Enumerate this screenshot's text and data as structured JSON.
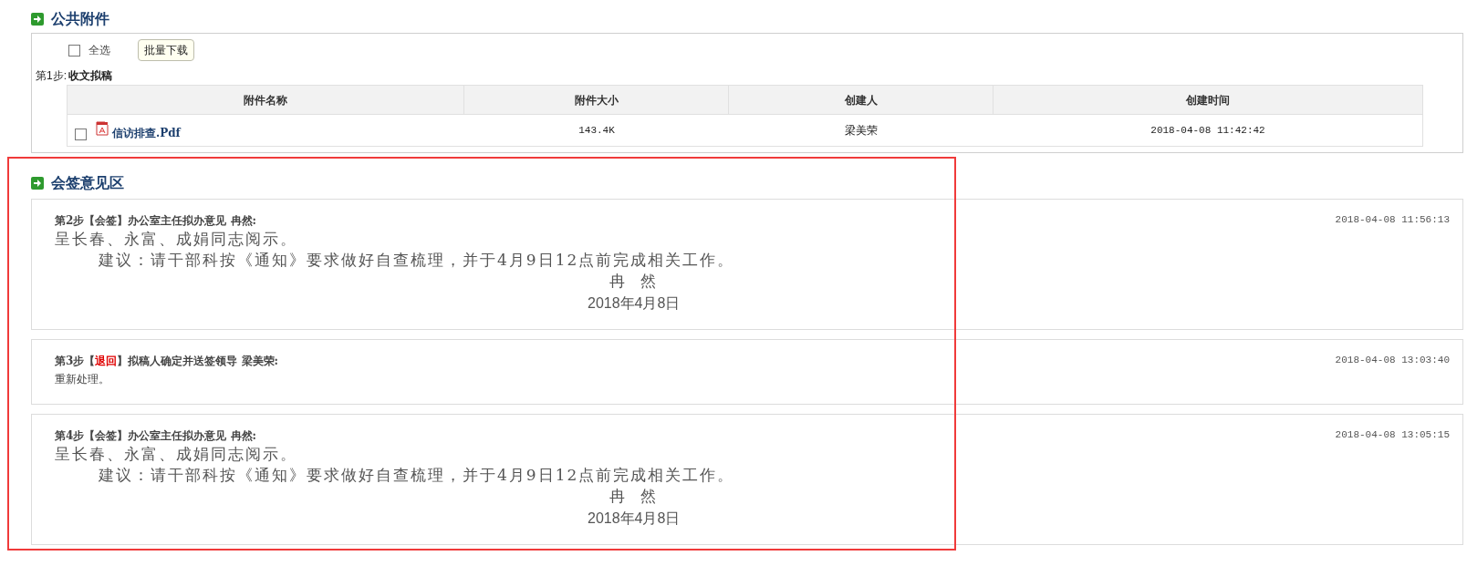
{
  "attachments": {
    "title": "公共附件",
    "select_all": {
      "label": "全选",
      "checked": false
    },
    "batch_button": "批量下载",
    "step": {
      "prefix": "第1步:",
      "name": "收文拟稿"
    },
    "columns": [
      "附件名称",
      "附件大小",
      "创建人",
      "创建时间"
    ],
    "rows": [
      {
        "checked": false,
        "name": "信访排查.Pdf",
        "size": "143.4K",
        "creator": "梁美荣",
        "time": "2018-04-08 11:42:42"
      }
    ]
  },
  "opinions": {
    "title": "会签意见区",
    "entries": [
      {
        "prefix": "第2步【",
        "tag": "会签",
        "kind": "countersign",
        "suffix": "】办公室主任拟办意见 冉然:",
        "time": "2018-04-08 11:56:13",
        "lines": [
          {
            "kind": "large",
            "text": "呈长春、永富、成娟同志阅示。"
          },
          {
            "kind": "indent",
            "text": "建议：请干部科按《通知》要求做好自查梳理，并于4月9日12点前完成相关工作。"
          },
          {
            "kind": "sign",
            "text": "冉　然"
          },
          {
            "kind": "date",
            "text": "2018年4月8日"
          }
        ]
      },
      {
        "prefix": "第3步【",
        "tag": "退回",
        "kind": "return",
        "suffix": "】拟稿人确定并送签领导 梁美荣:",
        "time": "2018-04-08 13:03:40",
        "lines": [
          {
            "kind": "small",
            "text": "重新处理。"
          }
        ]
      },
      {
        "prefix": "第4步【",
        "tag": "会签",
        "kind": "countersign",
        "suffix": "】办公室主任拟办意见 冉然:",
        "time": "2018-04-08 13:05:15",
        "lines": [
          {
            "kind": "large",
            "text": "呈长春、永富、成娟同志阅示。"
          },
          {
            "kind": "indent",
            "text": "建议：请干部科按《通知》要求做好自查梳理，并于4月9日12点前完成相关工作。"
          },
          {
            "kind": "sign",
            "text": "冉　然"
          },
          {
            "kind": "date",
            "text": "2018年4月8日"
          }
        ]
      }
    ]
  }
}
